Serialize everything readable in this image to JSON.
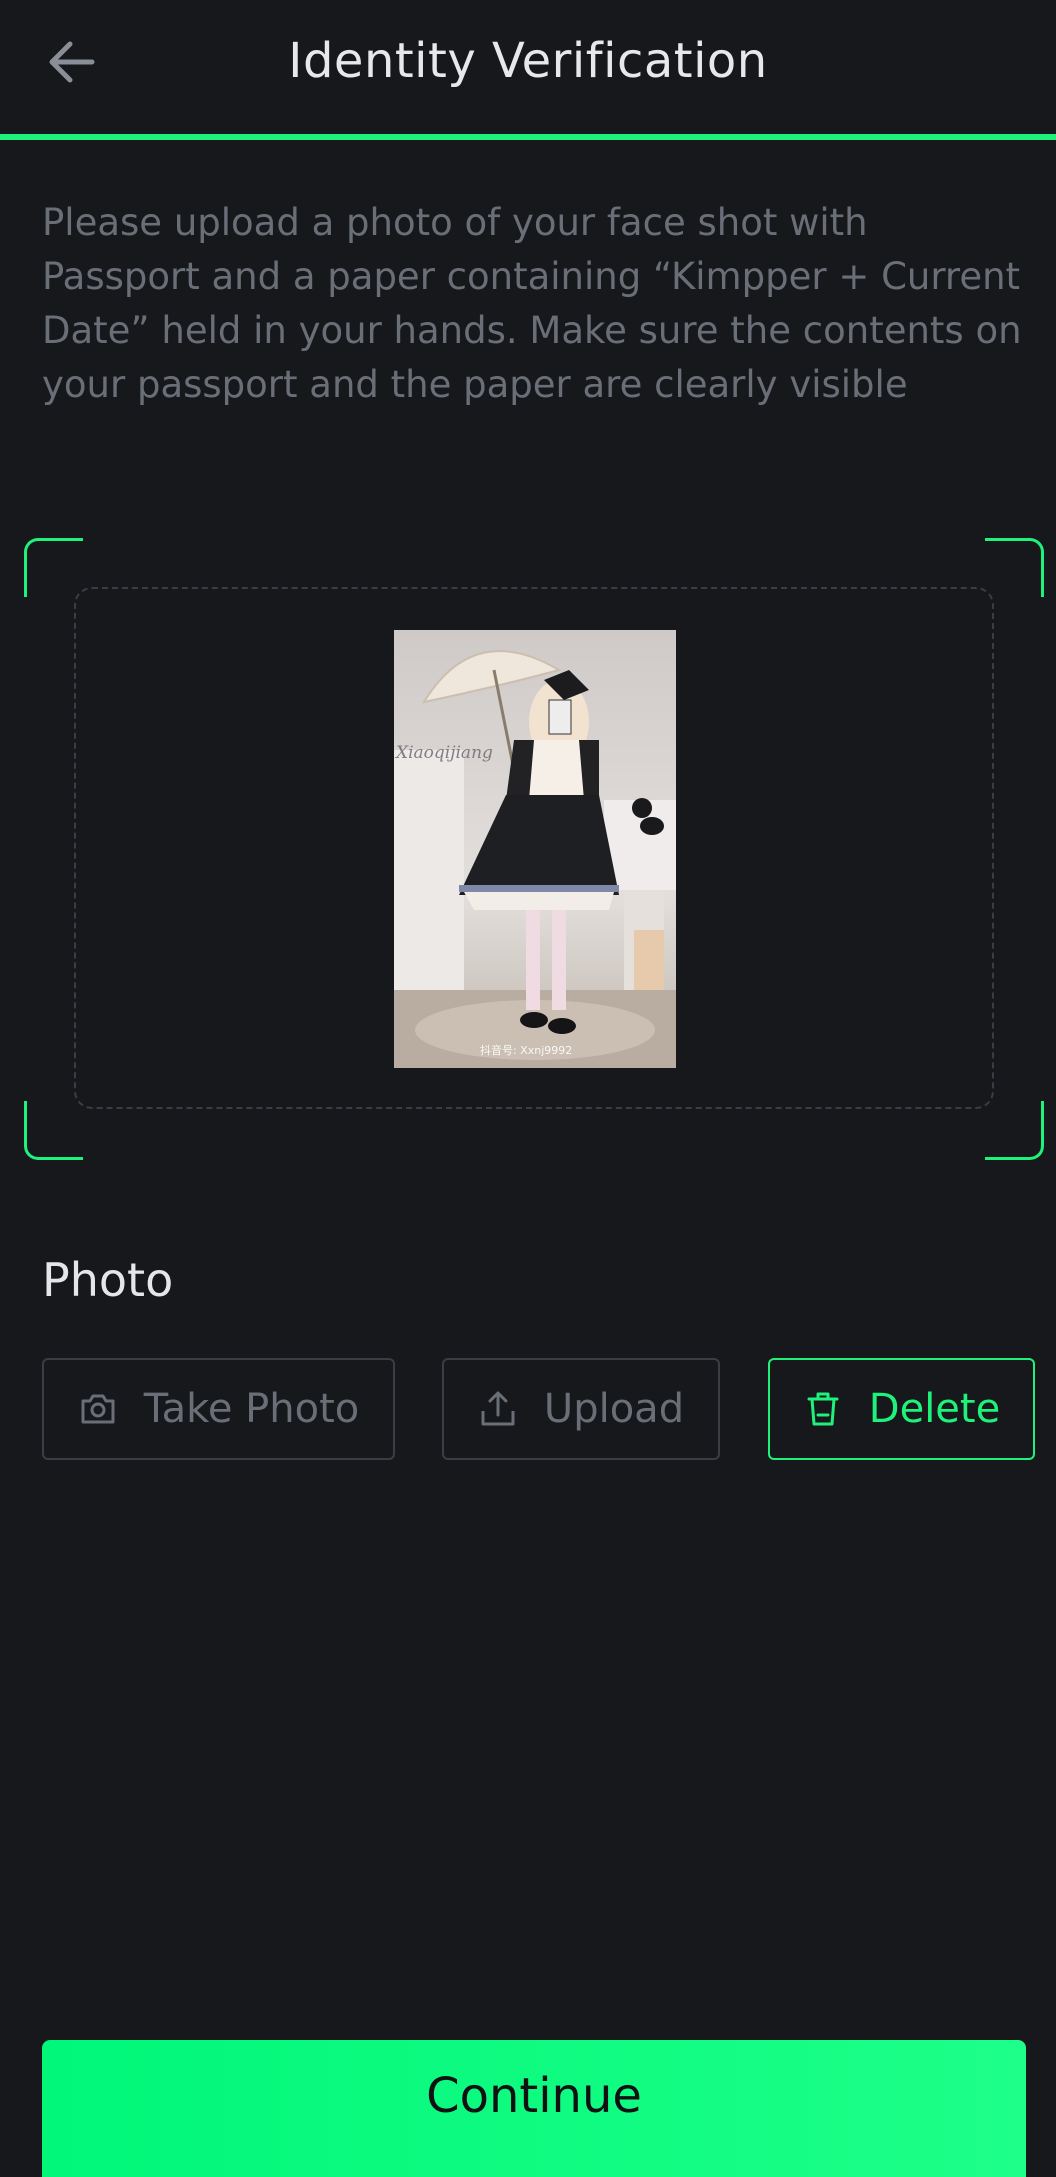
{
  "header": {
    "title": "Identity Verification",
    "back_icon": "arrow-left-icon"
  },
  "instructions": "Please upload a photo of your face shot with Passport and a paper containing “Kimpper + Current Date” held in your hands. Make sure the contents on your passport and the paper are clearly visible",
  "preview": {
    "watermark_text": "Xiaoqijiang",
    "caption_text": "抖音号: Xxnj9992"
  },
  "photo_section": {
    "title": "Photo",
    "take_photo_label": "Take Photo",
    "take_photo_icon": "camera-icon",
    "upload_label": "Upload",
    "upload_icon": "upload-icon",
    "delete_label": "Delete",
    "delete_icon": "trash-icon"
  },
  "continue_label": "Continue",
  "colors": {
    "accent": "#1ff27a",
    "background": "#16181c",
    "muted_text": "#6a6e77",
    "border": "#3a3d44"
  }
}
